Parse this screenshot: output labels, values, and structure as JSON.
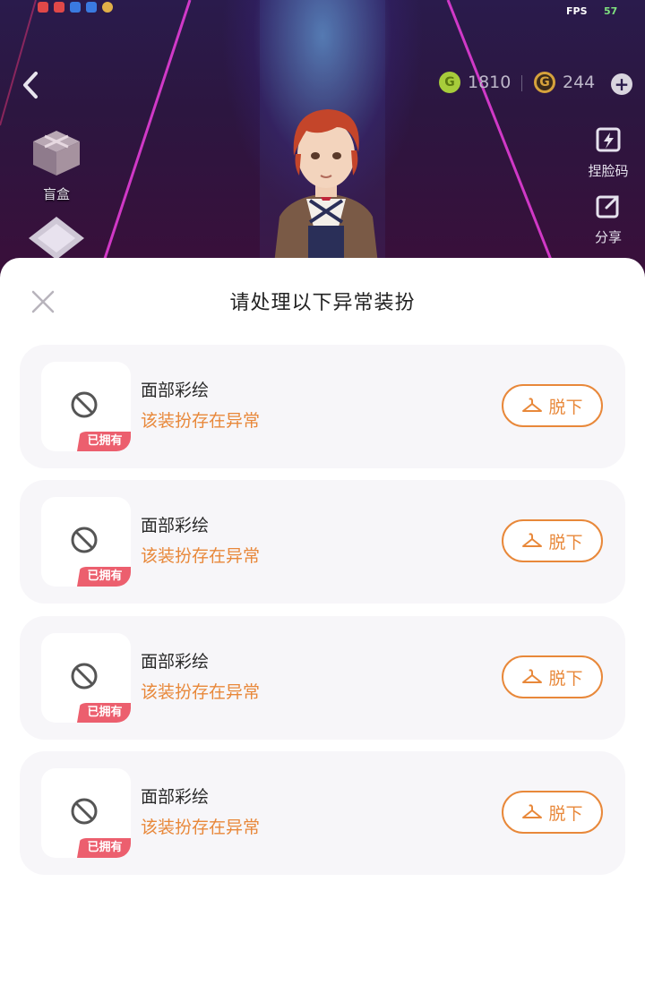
{
  "status_bar": {
    "fps_label": "FPS",
    "fps_value": "57"
  },
  "header": {
    "currency_green": {
      "icon": "coin-green-icon",
      "value": "1810"
    },
    "currency_gold": {
      "icon": "coin-gold-icon",
      "value": "244"
    }
  },
  "side_left": {
    "blind_box_label": "盲盒"
  },
  "side_right": {
    "face_code_label": "捏脸码",
    "share_label": "分享"
  },
  "sheet": {
    "title": "请处理以下异常装扮",
    "items": [
      {
        "name": "面部彩绘",
        "status": "该装扮存在异常",
        "badge": "已拥有",
        "button": "脱下"
      },
      {
        "name": "面部彩绘",
        "status": "该装扮存在异常",
        "badge": "已拥有",
        "button": "脱下"
      },
      {
        "name": "面部彩绘",
        "status": "该装扮存在异常",
        "badge": "已拥有",
        "button": "脱下"
      },
      {
        "name": "面部彩绘",
        "status": "该装扮存在异常",
        "badge": "已拥有",
        "button": "脱下"
      }
    ]
  },
  "colors": {
    "accent_orange": "#e8883a",
    "badge_red": "#ec5f6e",
    "card_bg": "#f7f6f9"
  }
}
